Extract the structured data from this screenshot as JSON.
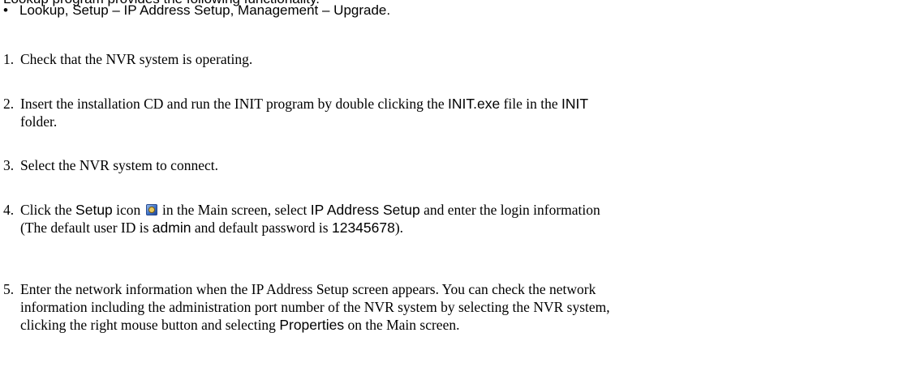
{
  "partial_top_line": "Lookup program provides the following functionality.",
  "bullet": {
    "symbol": "•",
    "text": "Lookup, Setup – IP Address Setup, Management – Upgrade."
  },
  "steps": [
    {
      "number": "1.",
      "text_1": "Check that the NVR system is operating."
    },
    {
      "number": "2.",
      "text_1": "Insert the installation CD and run the INIT program by double clicking the ",
      "term_1": "INIT.exe",
      "text_2": " file in the ",
      "term_2": "INIT",
      "text_3": "folder."
    },
    {
      "number": "3.",
      "text_1": "Select the NVR system to connect."
    },
    {
      "number": "4.",
      "text_1": "Click the ",
      "term_1": "Setup",
      "text_2": " icon ",
      "icon": "setup-icon",
      "text_3": " in the Main screen, select ",
      "term_2": "IP Address Setup",
      "text_4": " and enter the login information",
      "text_5": "(The default user ID is ",
      "term_3": "admin",
      "text_6": " and default password is ",
      "term_4": "12345678",
      "text_7": ")."
    },
    {
      "number": "5.",
      "text_1": "Enter the network information when the IP Address Setup screen appears.  You can check the network",
      "text_2": "information including the administration port number of the NVR system by selecting the NVR system,",
      "text_3": "clicking the right mouse button and selecting ",
      "term_1": "Properties",
      "text_4": " on the Main screen."
    }
  ]
}
